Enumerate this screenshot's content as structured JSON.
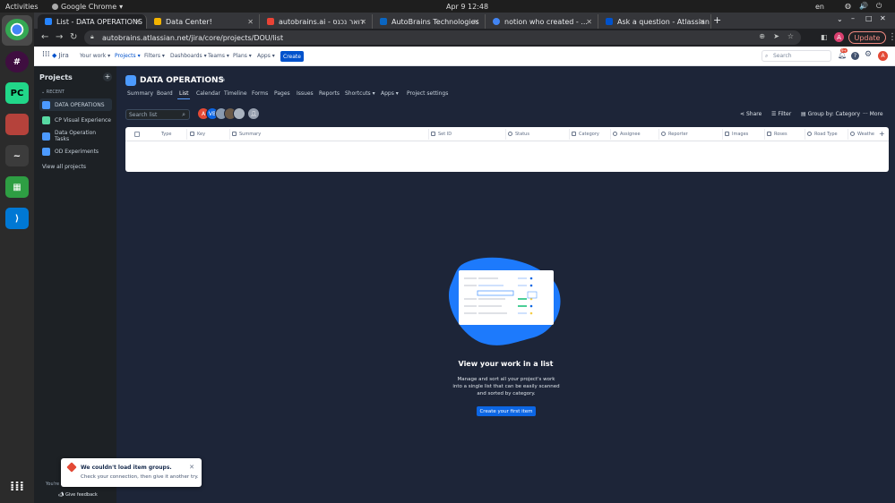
{
  "system": {
    "activities": "Activities",
    "app_name": "Google Chrome",
    "clock": "Apr 9  12:48",
    "lang": "en",
    "tray": [
      "◍",
      "🔊",
      "⏻"
    ]
  },
  "browser": {
    "tabs": [
      {
        "label": "List - DATA OPERATIONS",
        "color": "#2684ff"
      },
      {
        "label": "Data Center!",
        "color": "#f4b400"
      },
      {
        "label": "autobrains.ai - דואר נכנס",
        "color": "#ea4335"
      },
      {
        "label": "AutoBrains Technologies",
        "color": "#0a66c2"
      },
      {
        "label": "notion who created - ...",
        "color": "#4285f4"
      },
      {
        "label": "Ask a question - Atlassian",
        "color": "#0052cc"
      }
    ],
    "url": "autobrains.atlassian.net/jira/core/projects/DOU/list",
    "update_label": "Update",
    "profile_initial": "A"
  },
  "jira": {
    "product": "Jira",
    "nav": [
      "Your work",
      "Projects",
      "Filters",
      "Dashboards",
      "Teams",
      "Plans",
      "Apps"
    ],
    "create_label": "Create",
    "search_placeholder": "Search",
    "notif_count": "9+",
    "user_initial": "A"
  },
  "sidebar": {
    "title": "Projects",
    "section": "RECENT",
    "items": [
      {
        "label": "DATA OPERATIONS",
        "color": "#4c9aff"
      },
      {
        "label": "CP Visual Experience",
        "color": "#57d9a3"
      },
      {
        "label": "Data Operation Tasks",
        "color": "#4c9aff"
      },
      {
        "label": "OD Experiments",
        "color": "#4c9aff"
      }
    ],
    "view_all": "View all projects",
    "footer_truncated": "You're i",
    "feedback": "Give feedback"
  },
  "project": {
    "name": "DATA OPERATIONS",
    "tabs": [
      "Summary",
      "Board",
      "List",
      "Calendar",
      "Timeline",
      "Forms",
      "Pages",
      "Issues",
      "Reports",
      "Shortcuts",
      "Apps",
      "Project settings"
    ],
    "search_placeholder": "Search list",
    "avatars": [
      {
        "initials": "A",
        "color": "#e34935"
      },
      {
        "initials": "VB",
        "color": "#0c66e4"
      },
      {
        "initials": "",
        "color": "#8a9bb0"
      },
      {
        "initials": "",
        "color": "#6b5a48"
      },
      {
        "initials": "",
        "color": "#aab3bf"
      },
      {
        "initials": "",
        "color": "#97a0af"
      }
    ],
    "actions": {
      "share": "Share",
      "filter": "Filter",
      "group": "Group by: Category",
      "more": "More"
    },
    "columns": [
      "Type",
      "Key",
      "Summary",
      "Set ID",
      "Status",
      "Category",
      "Assignee",
      "Reporter",
      "Images",
      "Roses",
      "Road Type",
      "Weathe"
    ],
    "empty": {
      "title": "View your work in a list",
      "description": "Manage and sort all your project's work into a single list that can be easily scanned and sorted by category.",
      "button": "Create your first item"
    }
  },
  "toast": {
    "title": "We couldn't load item groups.",
    "message": "Check your connection, then give it another try."
  }
}
